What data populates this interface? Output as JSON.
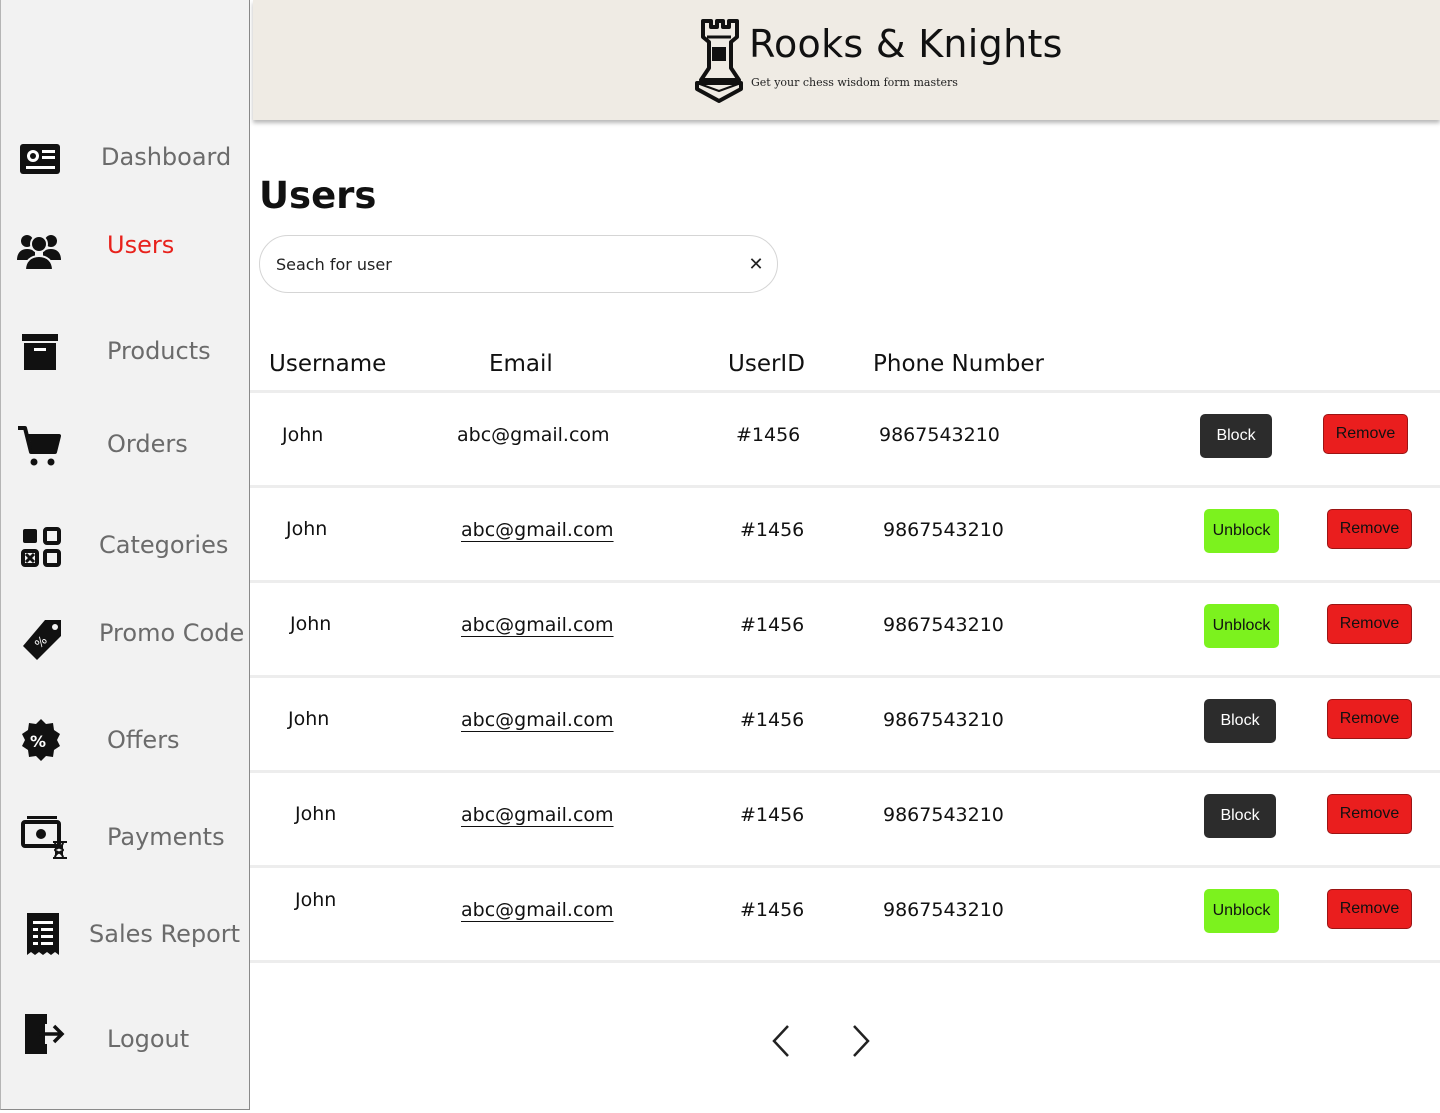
{
  "sidebar": {
    "items": [
      {
        "label": "Dashboard",
        "icon": "dashboard-icon",
        "active": false
      },
      {
        "label": "Users",
        "icon": "users-icon",
        "active": true
      },
      {
        "label": "Products",
        "icon": "archive-box-icon",
        "active": false
      },
      {
        "label": "Orders",
        "icon": "cart-icon",
        "active": false
      },
      {
        "label": "Categories",
        "icon": "categories-icon",
        "active": false
      },
      {
        "label": "Promo Code",
        "icon": "tag-icon",
        "active": false
      },
      {
        "label": "Offers",
        "icon": "percent-badge-icon",
        "active": false
      },
      {
        "label": "Payments",
        "icon": "payments-icon",
        "active": false
      },
      {
        "label": "Sales Report",
        "icon": "report-icon",
        "active": false
      },
      {
        "label": "Logout",
        "icon": "logout-icon",
        "active": false
      }
    ]
  },
  "header": {
    "brand": "Rooks & Knights",
    "tagline": "Get your chess wisdom form masters",
    "logo_icon": "rook-icon"
  },
  "main": {
    "title": "Users",
    "search": {
      "placeholder": "Seach for user",
      "value": "",
      "clear_icon": "close-icon"
    },
    "columns": [
      "Username",
      "Email",
      "UserID",
      "Phone Number"
    ],
    "rows": [
      {
        "username": "John",
        "email": "abc@gmail.com",
        "userid": "#1456",
        "phone": "9867543210",
        "status_action": "Block",
        "remove": "Remove"
      },
      {
        "username": "John",
        "email": "abc@gmail.com",
        "userid": "#1456",
        "phone": "9867543210",
        "status_action": "Unblock",
        "remove": "Remove"
      },
      {
        "username": "John",
        "email": "abc@gmail.com",
        "userid": "#1456",
        "phone": "9867543210",
        "status_action": "Unblock",
        "remove": "Remove"
      },
      {
        "username": "John",
        "email": "abc@gmail.com",
        "userid": "#1456",
        "phone": "9867543210",
        "status_action": "Block",
        "remove": "Remove"
      },
      {
        "username": "John",
        "email": "abc@gmail.com",
        "userid": "#1456",
        "phone": "9867543210",
        "status_action": "Block",
        "remove": "Remove"
      },
      {
        "username": "John",
        "email": "abc@gmail.com",
        "userid": "#1456",
        "phone": "9867543210",
        "status_action": "Unblock",
        "remove": "Remove"
      }
    ],
    "pagination": {
      "prev_icon": "chevron-left-icon",
      "next_icon": "chevron-right-icon"
    }
  },
  "colors": {
    "active_nav": "#e8221c",
    "block_button": "#2c2c2c",
    "unblock_button": "#7cf21e",
    "remove_button": "#ea1e1e",
    "header_bg": "#efebe4",
    "sidebar_bg": "#f2f2f2"
  }
}
